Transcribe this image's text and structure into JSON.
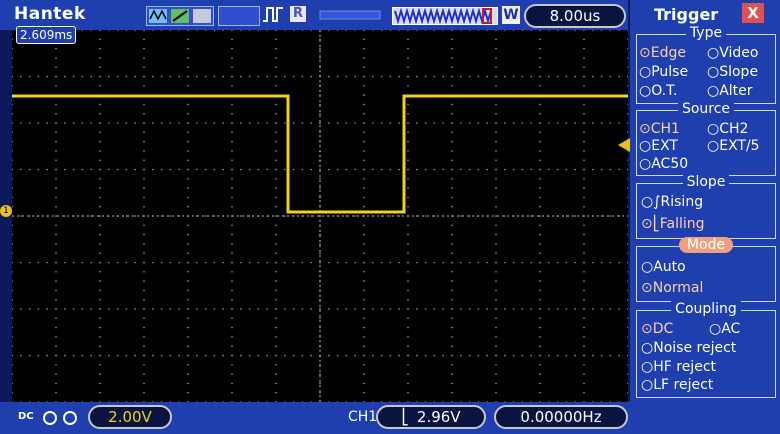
{
  "header": {
    "brand": "Hantek",
    "timebase": "8.00us",
    "w_badge": "W",
    "r_badge": "R"
  },
  "screen": {
    "cursor_time": "2.609ms"
  },
  "panel": {
    "title": "Trigger",
    "close": "X",
    "type": {
      "title": "Type",
      "options": [
        "Edge",
        "Video",
        "Pulse",
        "Slope",
        "O.T.",
        "Alter"
      ],
      "selected": "Edge"
    },
    "source": {
      "title": "Source",
      "options": [
        "CH1",
        "CH2",
        "EXT",
        "EXT/5",
        "AC50"
      ],
      "selected": "CH1"
    },
    "slope": {
      "title": "Slope",
      "options": [
        "Rising",
        "Falling"
      ],
      "selected": "Falling"
    },
    "mode": {
      "title": "Mode",
      "options": [
        "Auto",
        "Normal"
      ],
      "selected": "Normal"
    },
    "coupling": {
      "title": "Coupling",
      "options": [
        "DC",
        "AC",
        "Noise reject",
        "HF reject",
        "LF reject"
      ],
      "selected": "DC"
    }
  },
  "footer": {
    "volts_div": "2.00V",
    "trigger_channel": "CH1",
    "trigger_level": "2.96V",
    "frequency": "0.00000Hz"
  },
  "colors": {
    "trace": "#f2d21b",
    "screen_bg": "#000000",
    "ui_blue": "#1f3fae",
    "grid": "#9a9a9a"
  }
}
